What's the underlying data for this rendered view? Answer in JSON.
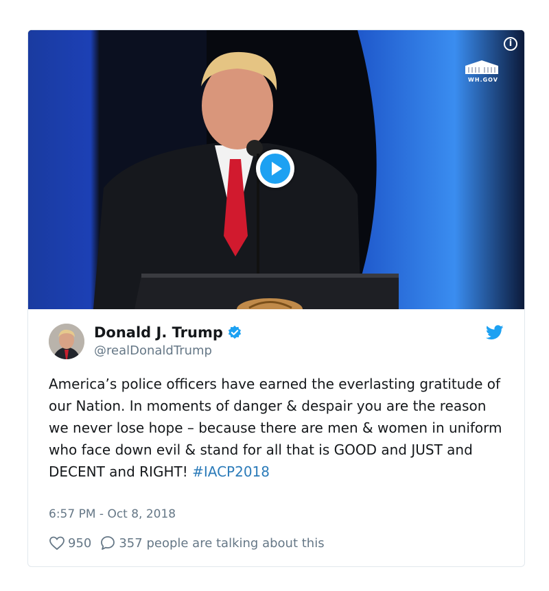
{
  "video": {
    "info_icon": "info-icon",
    "logo_text": "WH.GOV",
    "play_icon": "play-icon"
  },
  "tweet": {
    "author_name": "Donald J. Trump",
    "handle": "@realDonaldTrump",
    "verified_icon": "verified-badge-icon",
    "platform_icon": "twitter-bird-icon",
    "text_main": "America’s police officers have earned the everlasting gratitude of our Nation. In moments of danger & despair you are the reason we never lose hope – because there are men & women in uniform who face down evil & stand for all that is GOOD and JUST and DECENT and RIGHT! ",
    "hashtag": "#IACP2018",
    "timestamp": "6:57 PM - Oct 8, 2018",
    "likes": "950",
    "replies_text": "357 people are talking about this"
  },
  "colors": {
    "accent": "#1da1f2",
    "link": "#2b7bb9",
    "muted": "#657786"
  }
}
